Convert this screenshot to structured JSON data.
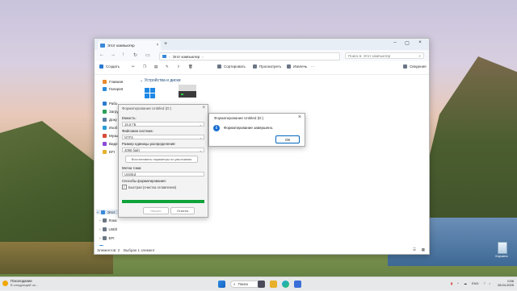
{
  "explorer": {
    "tab_title": "Этот компьютер",
    "address_path": "Этот компьютер",
    "search_placeholder": "Поиск в: Этот компьютер",
    "toolbar": {
      "create": "Создать",
      "sort": "Сортировать",
      "view": "Просмотреть",
      "eject": "Извлечь",
      "more": "···",
      "details": "Сведения"
    },
    "sidebar": [
      {
        "label": "Главная",
        "icon": "home-icon",
        "color": "#e88a2a"
      },
      {
        "label": "Галерея",
        "icon": "gallery-icon",
        "color": "#2a8ad8"
      },
      {
        "label": "Рабо",
        "icon": "desktop-folder-icon",
        "color": "#2a7ad1"
      },
      {
        "label": "Загру",
        "icon": "downloads-icon",
        "color": "#2aa05a"
      },
      {
        "label": "Доку",
        "icon": "documents-icon",
        "color": "#5a7aa0"
      },
      {
        "label": "Изоб",
        "icon": "pictures-icon",
        "color": "#2a9ad8"
      },
      {
        "label": "Музы",
        "icon": "music-icon",
        "color": "#d84a3a"
      },
      {
        "label": "Виде",
        "icon": "videos-icon",
        "color": "#8a4ad8"
      },
      {
        "label": "EFI",
        "icon": "drive-icon",
        "color": "#e8b02a"
      }
    ],
    "tree": [
      {
        "label": "Этот",
        "icon": "this-pc-icon"
      },
      {
        "label": "Лока",
        "icon": "drive-icon"
      },
      {
        "label": "Untitl",
        "icon": "drive-icon"
      },
      {
        "label": "EFI",
        "icon": "drive-icon"
      },
      {
        "label": "Сеть",
        "icon": "network-icon"
      }
    ],
    "group_label": "Устройства и диски",
    "status_items": "Элементов: 2",
    "status_selected": "Выбран 1 элемент"
  },
  "format_dialog": {
    "title": "Форматирование Untitled (D:)",
    "capacity_label": "Емкость:",
    "capacity_value": "15,5 ГБ",
    "fs_label": "Файловая система:",
    "fs_value": "NTFS",
    "alloc_label": "Размер единицы распределения:",
    "alloc_value": "4096 байт",
    "restore_btn": "Восстановить параметры по умолчанию",
    "vol_label": "Метка тома:",
    "vol_value": "Untitled",
    "methods_label": "Способы форматирования:",
    "quick_format": "Быстрая (очистка оглавления)",
    "progress": 1.0,
    "start_btn": "Начать",
    "close_btn": "Отмена"
  },
  "message_box": {
    "title": "Форматирование Untitled (D:)",
    "text": "Форматирование завершено.",
    "ok": "ОК"
  },
  "desktop": {
    "recycle_bin": "Корзина"
  },
  "taskbar": {
    "weather_title": "Похолодание",
    "weather_sub": "В следующий ча...",
    "search": "Поиск",
    "lang": "ENG",
    "time": "0:56",
    "date": "28.04.2025"
  }
}
